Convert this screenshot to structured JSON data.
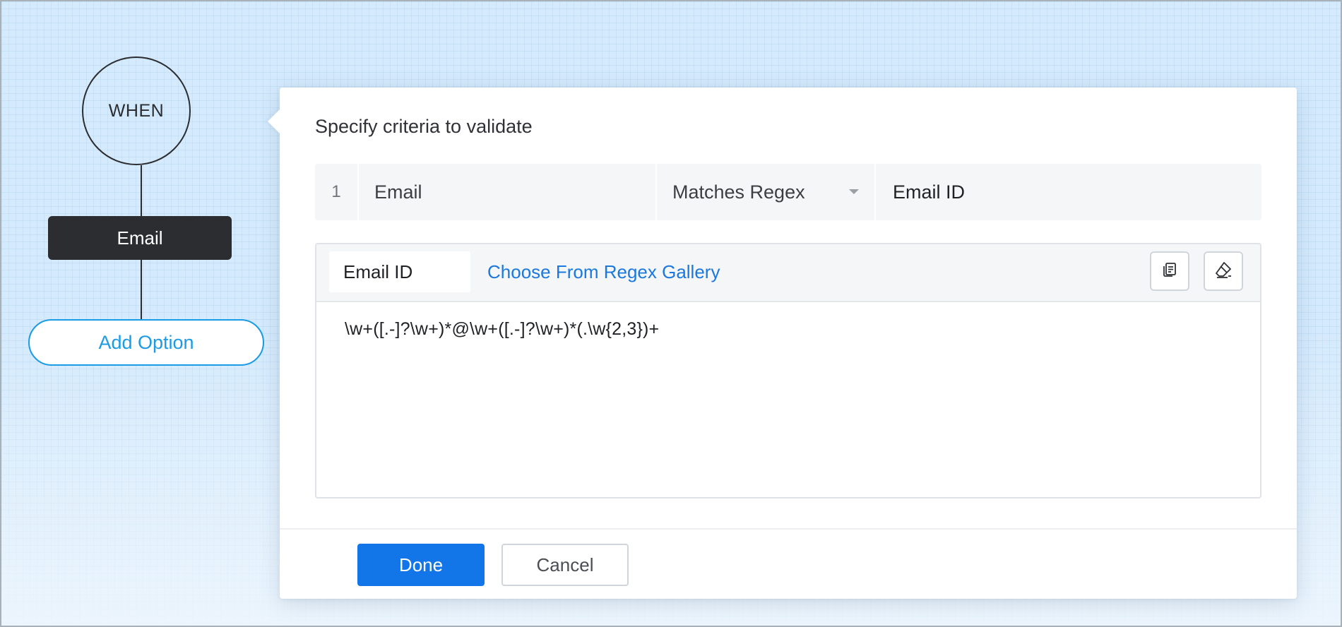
{
  "flow": {
    "when_label": "WHEN",
    "field_node_label": "Email",
    "add_option_label": "Add Option"
  },
  "dialog": {
    "title": "Specify criteria to validate",
    "criteria": {
      "index": "1",
      "field": "Email",
      "operator": "Matches Regex",
      "value": "Email ID"
    },
    "regex": {
      "name": "Email ID",
      "gallery_link": "Choose From Regex Gallery",
      "pattern": "\\w+([.-]?\\w+)*@\\w+([.-]?\\w+)*(.\\w{2,3})+",
      "toolbar_icons": [
        "copy-icon",
        "eraser-icon"
      ]
    },
    "buttons": {
      "done": "Done",
      "cancel": "Cancel"
    }
  },
  "colors": {
    "primary": "#1376e8",
    "link": "#1b78de",
    "add_option": "#1a9be6",
    "node_dark": "#2b2d31",
    "canvas_bg": "#d5eafc"
  }
}
